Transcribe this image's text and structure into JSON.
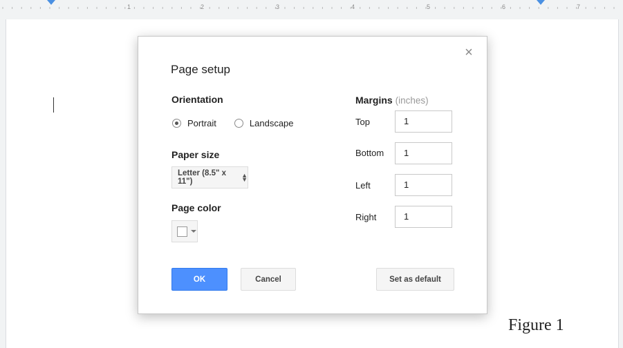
{
  "ruler": {
    "numbers": [
      "1",
      "2",
      "3",
      "4",
      "5",
      "6",
      "7"
    ]
  },
  "dialog": {
    "title": "Page setup",
    "close_label": "×",
    "orientation": {
      "label": "Orientation",
      "options": [
        "Portrait",
        "Landscape"
      ],
      "selected": "Portrait"
    },
    "paper_size": {
      "label": "Paper size",
      "value": "Letter (8.5\" x 11\")"
    },
    "page_color": {
      "label": "Page color",
      "value": "#ffffff"
    },
    "margins": {
      "label": "Margins",
      "unit": "(inches)",
      "top_label": "Top",
      "top_value": "1",
      "bottom_label": "Bottom",
      "bottom_value": "1",
      "left_label": "Left",
      "left_value": "1",
      "right_label": "Right",
      "right_value": "1"
    },
    "buttons": {
      "ok": "OK",
      "cancel": "Cancel",
      "set_default": "Set as default"
    }
  },
  "caption": "Figure 1",
  "colors": {
    "accent": "#4d90fe",
    "ruler_marker": "#4a90e2"
  },
  "icons": {
    "close": "close-icon",
    "select_arrows": "updown-arrows-icon",
    "dropdown": "chevron-down-icon"
  }
}
